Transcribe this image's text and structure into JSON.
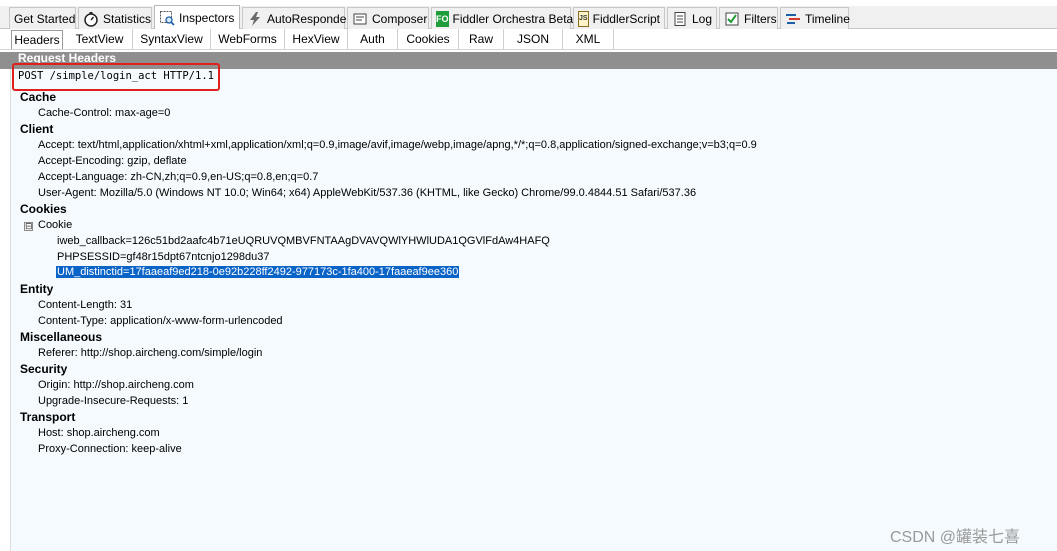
{
  "main_tabs": [
    {
      "label": "Get Started",
      "icon": "none"
    },
    {
      "label": "Statistics",
      "icon": "stopwatch-icon"
    },
    {
      "label": "Inspectors",
      "icon": "inspector-icon"
    },
    {
      "label": "AutoResponder",
      "icon": "lightning-icon"
    },
    {
      "label": "Composer",
      "icon": "composer-icon"
    },
    {
      "label": "Fiddler Orchestra Beta",
      "icon": "fo-icon",
      "icon_text": "FO"
    },
    {
      "label": "FiddlerScript",
      "icon": "script-icon",
      "icon_text": "JS"
    },
    {
      "label": "Log",
      "icon": "log-icon"
    },
    {
      "label": "Filters",
      "icon": "checkbox-icon"
    },
    {
      "label": "Timeline",
      "icon": "timeline-icon"
    }
  ],
  "active_main_tab": "Inspectors",
  "sub_tabs": [
    "Headers",
    "TextView",
    "SyntaxView",
    "WebForms",
    "HexView",
    "Auth",
    "Cookies",
    "Raw",
    "JSON",
    "XML"
  ],
  "active_sub_tab": "Headers",
  "section_title": "Request Headers",
  "request_line": "POST /simple/login_act HTTP/1.1",
  "groups": {
    "cache": {
      "title": "Cache",
      "items": [
        "Cache-Control: max-age=0"
      ]
    },
    "client": {
      "title": "Client",
      "items": [
        "Accept: text/html,application/xhtml+xml,application/xml;q=0.9,image/avif,image/webp,image/apng,*/*;q=0.8,application/signed-exchange;v=b3;q=0.9",
        "Accept-Encoding: gzip, deflate",
        "Accept-Language: zh-CN,zh;q=0.9,en-US;q=0.8,en;q=0.7",
        "User-Agent: Mozilla/5.0 (Windows NT 10.0; Win64; x64) AppleWebKit/537.36 (KHTML, like Gecko) Chrome/99.0.4844.51 Safari/537.36"
      ]
    },
    "cookies": {
      "title": "Cookies",
      "cookie_label": "Cookie",
      "expander": "⊟",
      "items": [
        "iweb_callback=126c51bd2aafc4b71eUQRUVQMBVFNTAAgDVAVQWlYHWlUDA1QGVlFdAw4HAFQ",
        "PHPSESSID=gf48r15dpt67ntcnjo1298du37",
        "UM_distinctid=17faaeaf9ed218-0e92b228ff2492-977173c-1fa400-17faaeaf9ee360"
      ]
    },
    "entity": {
      "title": "Entity",
      "items": [
        "Content-Length: 31",
        "Content-Type: application/x-www-form-urlencoded"
      ]
    },
    "misc": {
      "title": "Miscellaneous",
      "items": [
        "Referer: http://shop.aircheng.com/simple/login"
      ]
    },
    "security": {
      "title": "Security",
      "items": [
        "Origin: http://shop.aircheng.com",
        "Upgrade-Insecure-Requests: 1"
      ]
    },
    "transport": {
      "title": "Transport",
      "items": [
        "Host: shop.aircheng.com",
        "Proxy-Connection: keep-alive"
      ]
    }
  },
  "watermark": "CSDN @罐装七喜",
  "colors": {
    "selection": "#0a64c8",
    "highlight_box": "#e0201c",
    "section_band": "#8f8f8f"
  }
}
